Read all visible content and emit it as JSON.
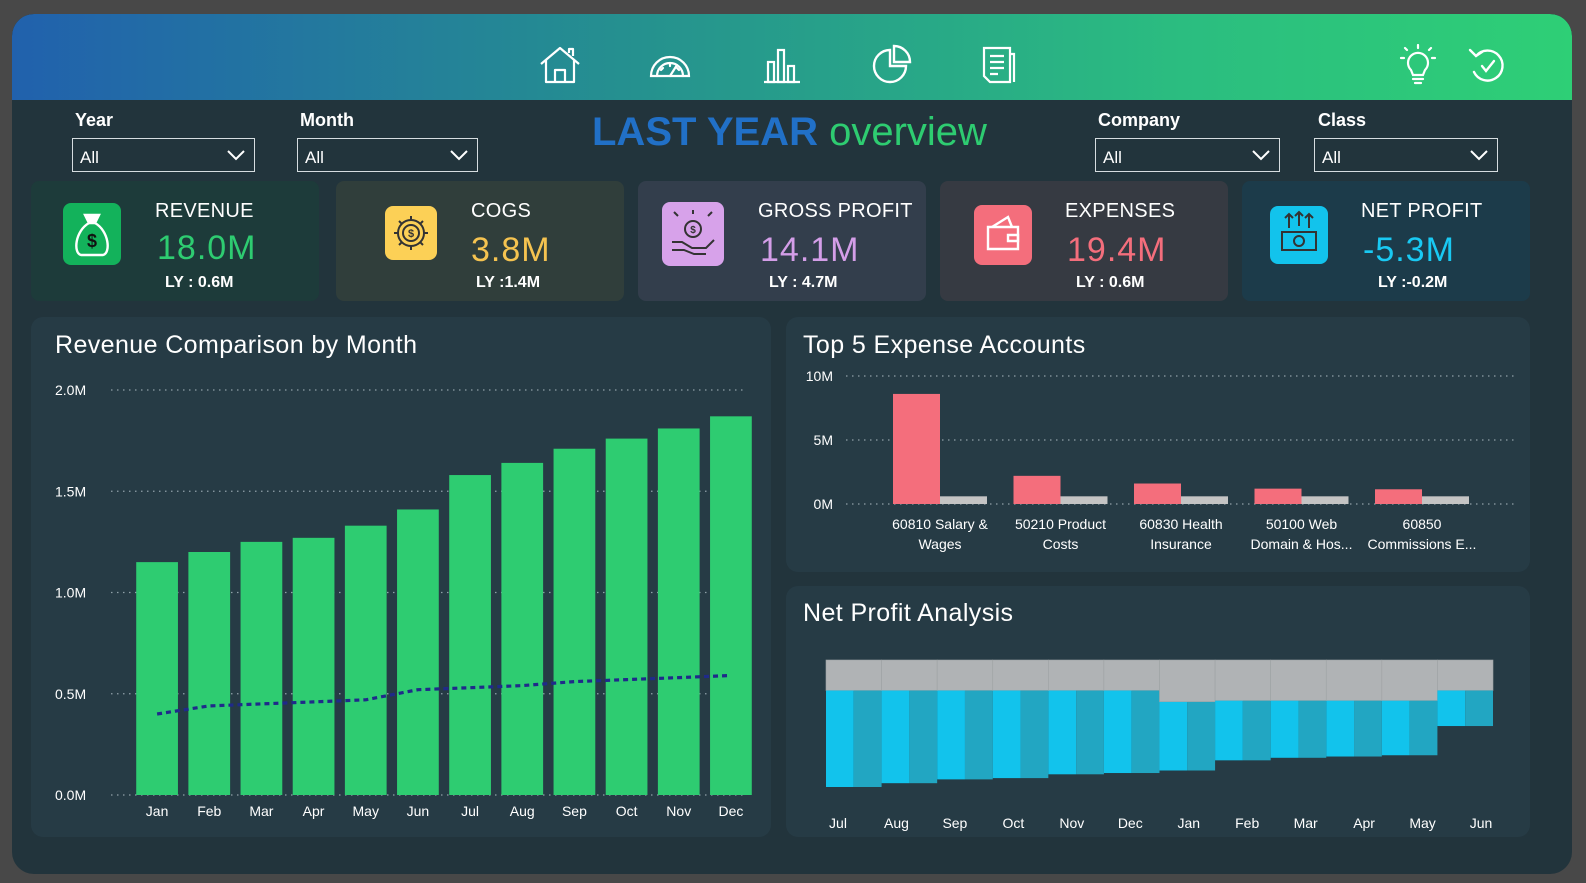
{
  "nav": {
    "icons": [
      "home-icon",
      "speedometer-icon",
      "bar-chart-icon",
      "pie-chart-icon",
      "report-icon"
    ],
    "right_icons": [
      "lightbulb-icon",
      "reset-icon"
    ]
  },
  "filters": {
    "year": {
      "label": "Year",
      "value": "All"
    },
    "month": {
      "label": "Month",
      "value": "All"
    },
    "company": {
      "label": "Company",
      "value": "All"
    },
    "class": {
      "label": "Class",
      "value": "All"
    }
  },
  "title": {
    "part1": "LAST YEAR",
    "part2": "overview"
  },
  "kpis": [
    {
      "label": "REVENUE",
      "value": "18.0M",
      "ly": "LY : 0.6M",
      "value_color": "#2ecc71",
      "icon": "money-bag-icon",
      "icon_bg": "#13b25b",
      "card_bg": "#1d3b3a"
    },
    {
      "label": "COGS",
      "value": "3.8M",
      "ly": "LY :1.4M",
      "value_color": "#f5c350",
      "icon": "gear-dollar-icon",
      "icon_bg": "#fcd056",
      "card_bg": "#303e3b"
    },
    {
      "label": "GROSS PROFIT",
      "value": "14.1M",
      "ly": "LY : 4.7M",
      "value_color": "#d49ee8",
      "icon": "hand-profit-icon",
      "icon_bg": "#d7a2ea",
      "card_bg": "#333e4c"
    },
    {
      "label": "EXPENSES",
      "value": "19.4M",
      "ly": "LY : 0.6M",
      "value_color": "#f46e7c",
      "icon": "wallet-icon",
      "icon_bg": "#f46e7c",
      "card_bg": "#363a42"
    },
    {
      "label": "NET PROFIT",
      "value": "-5.3M",
      "ly": "LY :-0.2M",
      "value_color": "#19c9f3",
      "icon": "cash-growth-icon",
      "icon_bg": "#12c3ec",
      "card_bg": "#1c3b4a"
    }
  ],
  "revenue_panel": {
    "title": "Revenue Comparison by Month"
  },
  "expense_panel": {
    "title": "Top 5 Expense Accounts"
  },
  "netprofit_panel": {
    "title": "Net Profit Analysis"
  },
  "chart_data": [
    {
      "type": "bar",
      "title": "Revenue Comparison by Month",
      "categories": [
        "Jan",
        "Feb",
        "Mar",
        "Apr",
        "May",
        "Jun",
        "Jul",
        "Aug",
        "Sep",
        "Oct",
        "Nov",
        "Dec"
      ],
      "series": [
        {
          "values": [
            1.15,
            1.2,
            1.25,
            1.27,
            1.33,
            1.41,
            1.58,
            1.64,
            1.71,
            1.76,
            1.81,
            1.87
          ],
          "color": "#2ecc71"
        },
        {
          "values": [
            0.4,
            0.44,
            0.45,
            0.46,
            0.47,
            0.52,
            0.53,
            0.54,
            0.56,
            0.57,
            0.58,
            0.59
          ],
          "color": "#1f2a8a",
          "style": "dashed-line"
        }
      ],
      "ylim": [
        0,
        2.0
      ],
      "yticks": [
        "0.0M",
        "0.5M",
        "1.0M",
        "1.5M",
        "2.0M"
      ],
      "ytick_values": [
        0,
        0.5,
        1.0,
        1.5,
        2.0
      ],
      "grid": true
    },
    {
      "type": "bar",
      "title": "Top 5 Expense Accounts",
      "categories": [
        [
          "60810 Salary &",
          "Wages"
        ],
        [
          "50210 Product",
          "Costs"
        ],
        [
          "60830 Health",
          "Insurance"
        ],
        [
          "50100 Web",
          "Domain & Hos..."
        ],
        [
          "60850",
          "Commissions E..."
        ]
      ],
      "series": [
        {
          "values": [
            8.6,
            2.2,
            1.6,
            1.2,
            1.15
          ],
          "color": "#f46e7c"
        },
        {
          "values": [
            0.6,
            0.6,
            0.6,
            0.6,
            0.6
          ],
          "color": "#c4c4c4"
        }
      ],
      "ylim": [
        0,
        10
      ],
      "yticks": [
        "0M",
        "5M",
        "10M"
      ],
      "ytick_values": [
        0,
        5,
        10
      ],
      "grid": true
    },
    {
      "type": "area",
      "title": "Net Profit Analysis",
      "categories": [
        "Jul",
        "Aug",
        "Sep",
        "Oct",
        "Nov",
        "Dec",
        "Jan",
        "Feb",
        "Mar",
        "Apr",
        "May",
        "Jun"
      ],
      "series": [
        {
          "values": [
            0.76,
            0.73,
            0.7,
            0.69,
            0.66,
            0.65,
            0.54,
            0.46,
            0.44,
            0.43,
            0.42,
            0.28
          ],
          "color": "#12c3ec"
        },
        {
          "values": [
            0.24,
            0.24,
            0.24,
            0.24,
            0.24,
            0.24,
            0.33,
            0.32,
            0.32,
            0.32,
            0.32,
            0.24
          ],
          "color": "#b0b3b5"
        }
      ],
      "grid": false
    }
  ]
}
